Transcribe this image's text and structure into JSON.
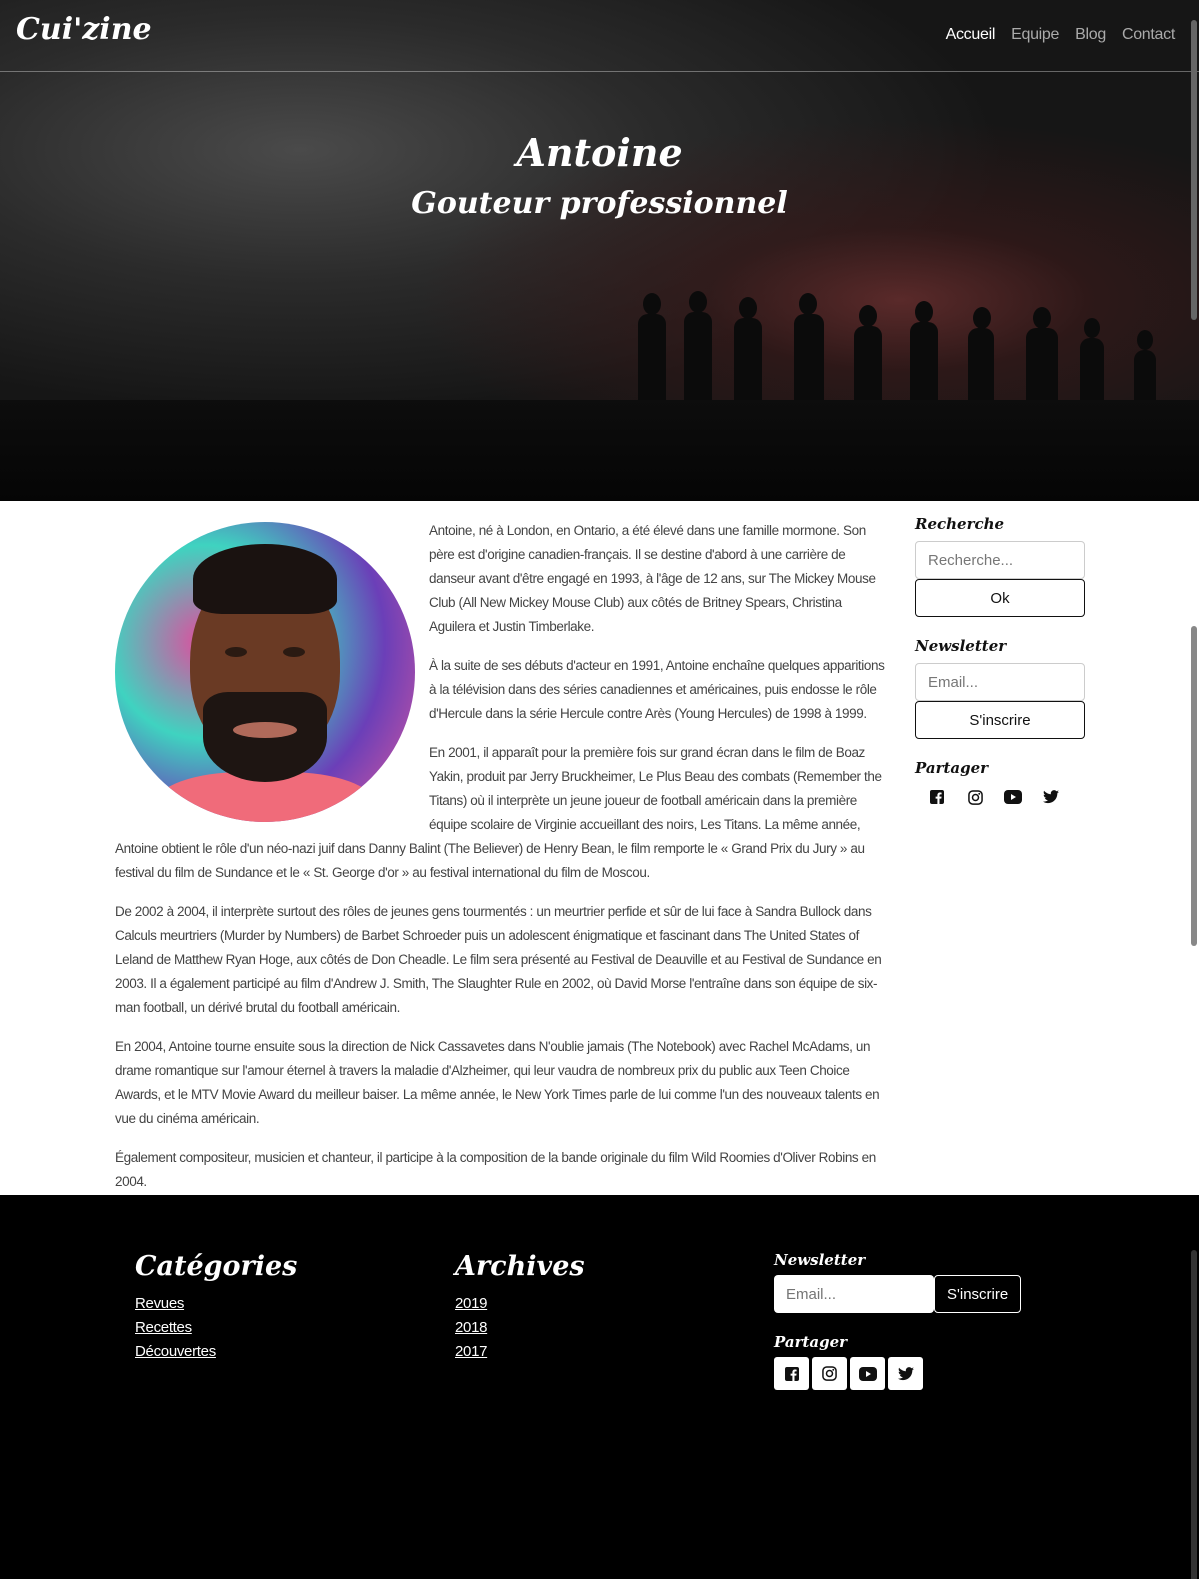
{
  "nav": {
    "brand": "Cui'zine",
    "links": [
      "Accueil",
      "Equipe",
      "Blog",
      "Contact"
    ]
  },
  "hero": {
    "title": "Antoine",
    "subtitle": "Gouteur professionnel"
  },
  "article": {
    "paragraphs": [
      "Antoine, né à London, en Ontario, a été élevé dans une famille mormone. Son père est d'origine canadien-français. Il se destine d'abord à une carrière de danseur avant d'être engagé en 1993, à l'âge de 12 ans, sur The Mickey Mouse Club (All New Mickey Mouse Club) aux côtés de Britney Spears, Christina Aguilera et Justin Timberlake.",
      "À la suite de ses débuts d'acteur en 1991, Antoine enchaîne quelques apparitions à la télévision dans des séries canadiennes et américaines, puis endosse le rôle d'Hercule dans la série Hercule contre Arès (Young Hercules) de 1998 à 1999.",
      "En 2001, il apparaît pour la première fois sur grand écran dans le film de Boaz Yakin, produit par Jerry Bruckheimer, Le Plus Beau des combats (Remember the Titans) où il interprète un jeune joueur de football américain dans la première équipe scolaire de Virginie accueillant des noirs, Les Titans. La même année, Antoine obtient le rôle d'un néo-nazi juif dans Danny Balint (The Believer) de Henry Bean, le film remporte le « Grand Prix du Jury » au festival du film de Sundance et le « St. George d'or » au festival international du film de Moscou.",
      "De 2002 à 2004, il interprète surtout des rôles de jeunes gens tourmentés : un meurtrier perfide et sûr de lui face à Sandra Bullock dans Calculs meurtriers (Murder by Numbers) de Barbet Schroeder puis un adolescent énigmatique et fascinant dans The United States of Leland de Matthew Ryan Hoge, aux côtés de Don Cheadle. Le film sera présenté au Festival de Deauville et au Festival de Sundance en 2003. Il a également participé au film d'Andrew J. Smith, The Slaughter Rule en 2002, où David Morse l'entraîne dans son équipe de six-man football, un dérivé brutal du football américain.",
      "En 2004, Antoine tourne ensuite sous la direction de Nick Cassavetes dans N'oublie jamais (The Notebook) avec Rachel McAdams, un drame romantique sur l'amour éternel à travers la maladie d'Alzheimer, qui leur vaudra de nombreux prix du public aux Teen Choice Awards, et le MTV Movie Award du meilleur baiser. La même année, le New York Times parle de lui comme l'un des nouveaux talents en vue du cinéma américain.",
      "Également compositeur, musicien et chanteur, il participe à la composition de la bande originale du film Wild Roomies d'Oliver Robins en 2004."
    ]
  },
  "sidebar": {
    "search_heading": "Recherche",
    "search_placeholder": "Recherche...",
    "search_button": "Ok",
    "newsletter_heading": "Newsletter",
    "email_placeholder": "Email...",
    "subscribe_button": "S'inscrire",
    "share_heading": "Partager",
    "social_icons": [
      "facebook-icon",
      "instagram-icon",
      "youtube-icon",
      "twitter-icon"
    ]
  },
  "footer": {
    "categories_heading": "Catégories",
    "categories": [
      "Revues",
      "Recettes",
      "Découvertes"
    ],
    "archives_heading": "Archives",
    "archives": [
      "2019",
      "2018",
      "2017"
    ],
    "newsletter_heading": "Newsletter",
    "email_placeholder": "Email...",
    "subscribe_button": "S'inscrire",
    "share_heading": "Partager"
  }
}
